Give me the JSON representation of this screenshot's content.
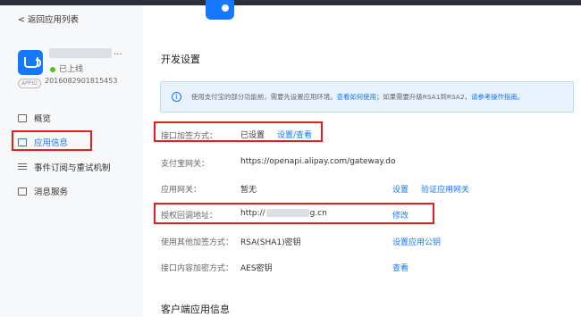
{
  "sidebar": {
    "back_label": "返回应用列表",
    "app": {
      "status": "已上线",
      "appid_badge": "APPID",
      "appid": "2016082901815453"
    },
    "items": [
      {
        "label": "概览"
      },
      {
        "label": "应用信息"
      },
      {
        "label": "事件订阅与重试机制"
      },
      {
        "label": "消息服务"
      }
    ]
  },
  "main": {
    "dev_settings_title": "开发设置",
    "notice": {
      "text": "使用支付宝的部分功能前，需要先设置应用环境。",
      "link1": "查看如何使用",
      "text2": "；如果需要升级RSA1到RSA2，",
      "link2": "请参考操作指南。"
    },
    "rows": [
      {
        "label": "接口加签方式：",
        "value": "已设置",
        "action": "设置/查看"
      },
      {
        "label": "支付宝网关：",
        "value": "https://openapi.alipay.com/gateway.do"
      },
      {
        "label": "应用网关：",
        "value": "暂无",
        "action": "设置",
        "action2": "验证应用网关"
      },
      {
        "label": "授权回调地址：",
        "value_prefix": "http://",
        "value_suffix": "g.cn",
        "action": "修改"
      },
      {
        "label": "使用其他加签方式：",
        "value": "RSA(SHA1)密钥",
        "action": "设置应用公钥"
      },
      {
        "label": "接口内容加密方式：",
        "value": "AES密钥",
        "action": "查看"
      }
    ],
    "client_title": "客户端应用信息"
  }
}
